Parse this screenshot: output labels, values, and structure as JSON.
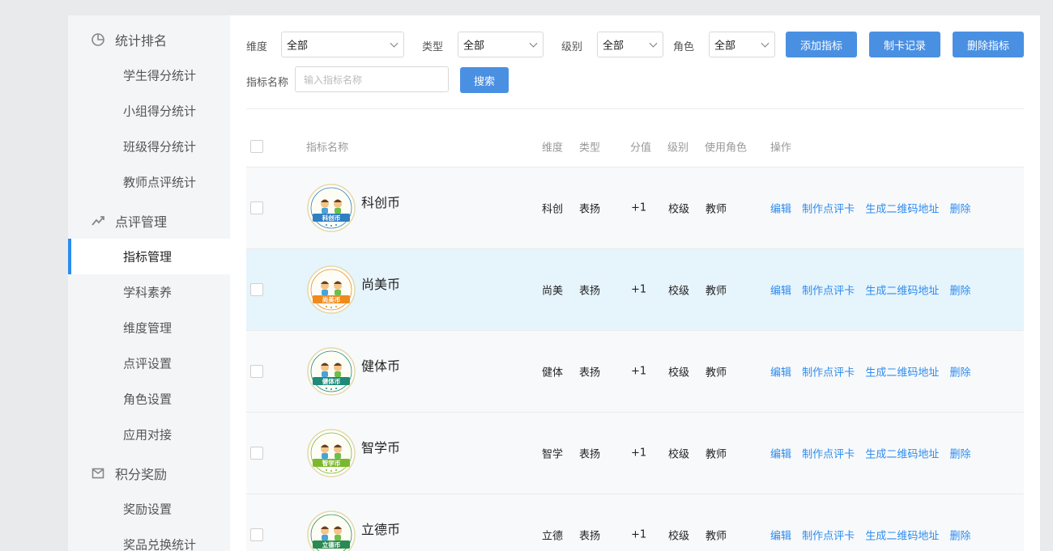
{
  "sidebar": {
    "groups": [
      {
        "label": "统计排名",
        "icon": "pie-chart-icon",
        "items": [
          "学生得分统计",
          "小组得分统计",
          "班级得分统计",
          "教师点评统计"
        ]
      },
      {
        "label": "点评管理",
        "icon": "trend-line-icon",
        "items": [
          "指标管理",
          "学科素养",
          "维度管理",
          "点评设置",
          "角色设置",
          "应用对接"
        ]
      },
      {
        "label": "积分奖励",
        "icon": "mail-icon",
        "items": [
          "奖励设置",
          "奖品兑换统计"
        ]
      }
    ],
    "active_item": "指标管理"
  },
  "filters": {
    "dimension_label": "维度",
    "dimension_value": "全部",
    "type_label": "类型",
    "type_value": "全部",
    "level_label": "级别",
    "level_value": "全部",
    "role_label": "角色",
    "role_value": "全部",
    "name_label": "指标名称",
    "name_placeholder": "输入指标名称",
    "search_button": "搜索"
  },
  "toolbar": {
    "add_button": "添加指标",
    "card_record_button": "制卡记录",
    "delete_button": "删除指标"
  },
  "table": {
    "columns": [
      "指标名称",
      "维度",
      "类型",
      "分值",
      "级别",
      "使用角色",
      "操作"
    ],
    "rows": [
      {
        "name": "科创币",
        "badge_text": "科创币",
        "color": "#2f7fc1",
        "dimension": "科创",
        "type": "表扬",
        "score": "+1",
        "level": "校级",
        "role": "教师"
      },
      {
        "name": "尚美币",
        "badge_text": "尚美币",
        "color": "#ef8a1c",
        "dimension": "尚美",
        "type": "表扬",
        "score": "+1",
        "level": "校级",
        "role": "教师"
      },
      {
        "name": "健体币",
        "badge_text": "健体币",
        "color": "#1e8a78",
        "dimension": "健体",
        "type": "表扬",
        "score": "+1",
        "level": "校级",
        "role": "教师"
      },
      {
        "name": "智学币",
        "badge_text": "智学币",
        "color": "#7cb82f",
        "dimension": "智学",
        "type": "表扬",
        "score": "+1",
        "level": "校级",
        "role": "教师"
      },
      {
        "name": "立德币",
        "badge_text": "立德币",
        "color": "#2a8a52",
        "dimension": "立德",
        "type": "表扬",
        "score": "+1",
        "level": "校级",
        "role": "教师"
      }
    ],
    "actions": [
      "编辑",
      "制作点评卡",
      "生成二维码地址",
      "删除"
    ]
  },
  "colors": {
    "accent": "#4a90e2",
    "link": "#2d8cf0",
    "active_bar": "#2d8cf0",
    "row_highlight": "#e6f4fc"
  }
}
